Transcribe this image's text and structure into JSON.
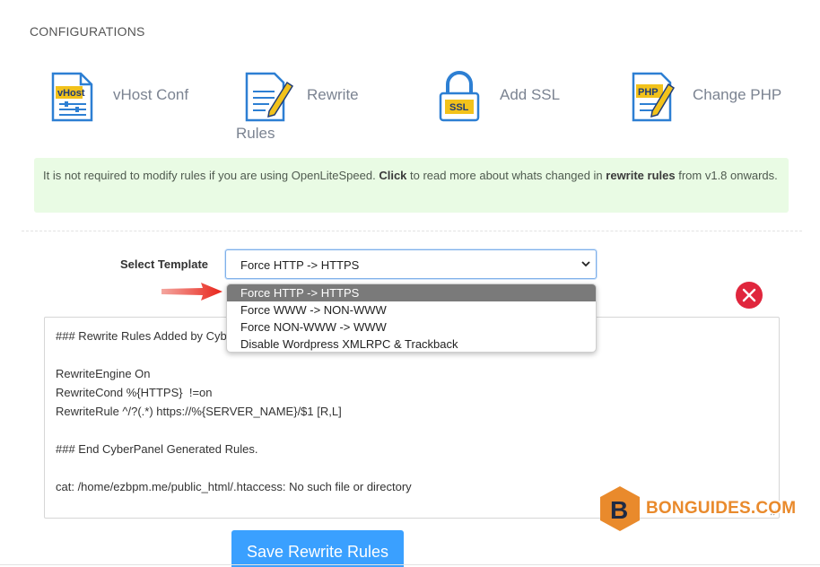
{
  "section": {
    "title": "CONFIGURATIONS"
  },
  "configs": [
    {
      "label": "vHost Conf",
      "icon": "vhost-icon",
      "icon_text": "vHost"
    },
    {
      "label_line1": "Rewrite",
      "label_line2": "Rules",
      "icon": "rewrite-icon"
    },
    {
      "label": "Add SSL",
      "icon": "ssl-lock-icon",
      "icon_text": "SSL"
    },
    {
      "label": "Change PHP",
      "icon": "php-icon",
      "icon_text": "PHP"
    }
  ],
  "notice": {
    "part1": "It is not required to modify rules if you are using OpenLiteSpeed. ",
    "click": "Click",
    "part2": " to read more about whats changed in ",
    "rewrite_rules": "rewrite rules",
    "part3": " from v1.8 onwards."
  },
  "template_select": {
    "label": "Select Template",
    "value": "Force HTTP -> HTTPS",
    "options": [
      "Force HTTP -> HTTPS",
      "Force WWW -> NON-WWW",
      "Force NON-WWW -> WWW",
      "Disable Wordpress XMLRPC & Trackback"
    ]
  },
  "editor": {
    "lines": [
      "### Rewrite Rules Added by CyberPanel.",
      "",
      "RewriteEngine On",
      "RewriteCond %{HTTPS}  !=on",
      "RewriteRule ^/?(.*) https://%{SERVER_NAME}/$1 [R,L]",
      "",
      "### End CyberPanel Generated Rules.",
      "",
      "cat: /home/ezbpm.me/public_html/.htaccess: No such file or directory"
    ]
  },
  "watermark": {
    "letter": "B",
    "text": "BONGUIDES.COM"
  },
  "actions": {
    "save_label": "Save Rewrite Rules"
  },
  "colors": {
    "accent": "#3aa0ff",
    "danger": "#e0263d",
    "notice_bg": "#e9fbe4",
    "icon_blue": "#2d7fd3",
    "icon_yellow": "#f2c21b",
    "watermark_orange": "#e98a2c"
  }
}
